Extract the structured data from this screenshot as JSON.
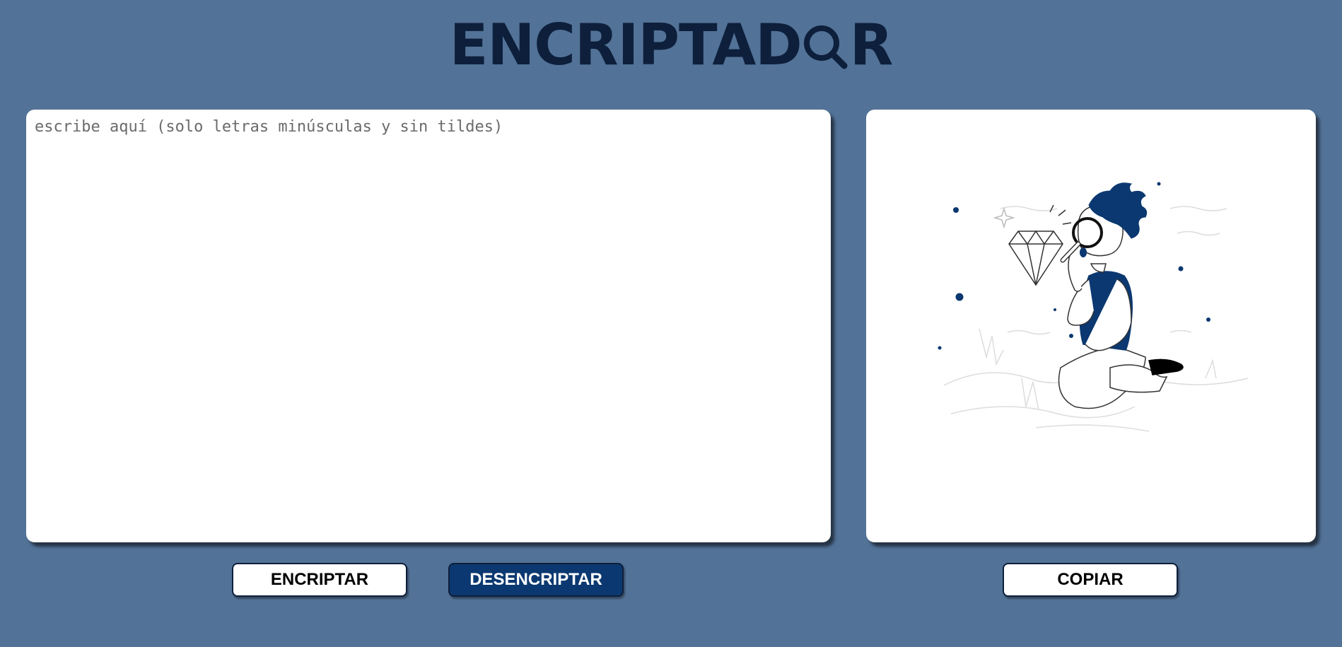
{
  "header": {
    "title_before": "ENCRIPTAD",
    "title_after": "R",
    "title_icon": "magnifier-o-icon"
  },
  "input": {
    "placeholder": "escribe aquí (solo letras minúsculas y sin tildes)",
    "value": ""
  },
  "output": {
    "illustration": "person-with-magnifying-glass-diamond-illustration"
  },
  "buttons": {
    "encrypt_label": "ENCRIPTAR",
    "decrypt_label": "DESENCRIPTAR",
    "copy_label": "COPIAR"
  },
  "colors": {
    "background": "#527297",
    "title": "#0d1f3b",
    "accent": "#0b3870",
    "panel": "#ffffff"
  }
}
